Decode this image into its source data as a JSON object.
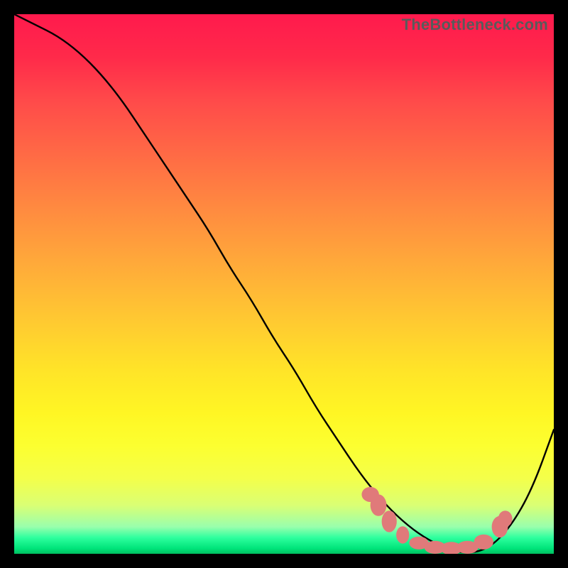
{
  "watermark": "TheBottleneck.com",
  "chart_data": {
    "type": "line",
    "title": "",
    "xlabel": "",
    "ylabel": "",
    "xlim": [
      0,
      100
    ],
    "ylim": [
      0,
      100
    ],
    "grid": false,
    "legend": false,
    "background": "red-yellow-green vertical gradient",
    "series": [
      {
        "name": "curve",
        "color": "#000000",
        "x": [
          0,
          4,
          8,
          12,
          16,
          20,
          24,
          28,
          32,
          36,
          40,
          44,
          48,
          52,
          56,
          60,
          64,
          68,
          72,
          76,
          80,
          84,
          88,
          92,
          96,
          100
        ],
        "y": [
          100,
          98,
          96,
          93,
          89,
          84,
          78,
          72,
          66,
          60,
          53,
          47,
          40,
          34,
          27,
          21,
          15,
          10,
          6,
          3,
          1,
          0,
          1,
          5,
          12,
          23
        ]
      }
    ],
    "markers": [
      {
        "x": 66,
        "y": 11,
        "rx": 1.6,
        "ry": 1.4
      },
      {
        "x": 67.5,
        "y": 9,
        "rx": 1.5,
        "ry": 2.0
      },
      {
        "x": 69.5,
        "y": 6,
        "rx": 1.4,
        "ry": 2.0
      },
      {
        "x": 72,
        "y": 3.5,
        "rx": 1.2,
        "ry": 1.6
      },
      {
        "x": 75,
        "y": 2,
        "rx": 1.8,
        "ry": 1.2
      },
      {
        "x": 78,
        "y": 1.2,
        "rx": 2.0,
        "ry": 1.2
      },
      {
        "x": 81,
        "y": 1.0,
        "rx": 2.0,
        "ry": 1.2
      },
      {
        "x": 84,
        "y": 1.2,
        "rx": 2.0,
        "ry": 1.2
      },
      {
        "x": 87,
        "y": 2.2,
        "rx": 1.8,
        "ry": 1.4
      },
      {
        "x": 90,
        "y": 5,
        "rx": 1.5,
        "ry": 2.0
      },
      {
        "x": 91,
        "y": 6.5,
        "rx": 1.3,
        "ry": 1.5
      }
    ]
  }
}
